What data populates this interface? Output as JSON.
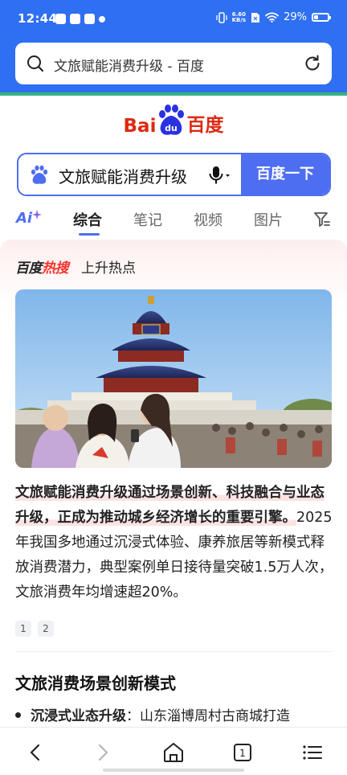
{
  "status_bar": {
    "time": "12:44",
    "net_speed_value": "6.60",
    "net_speed_unit": "KB/s",
    "battery_text": "29%",
    "battery_level": 0.29
  },
  "url_bar": {
    "text": "文旅赋能消费升级 - 百度"
  },
  "logo": {
    "left": "Bai",
    "paw": "du",
    "right": "百度"
  },
  "search": {
    "query": "文旅赋能消费升级",
    "button": "百度一下"
  },
  "tabs": {
    "ai": "Ai",
    "items": [
      "综合",
      "笔记",
      "视频",
      "图片"
    ],
    "active": "综合"
  },
  "hot": {
    "brand_a": "百度",
    "brand_b": "热搜",
    "subtitle": "上升热点"
  },
  "summary": {
    "highlight": "文旅赋能消费升级通过场景创新、科技融合与业态升级，正成为推动城乡经济增长的重要引擎。",
    "body": "2025年我国多地通过沉浸式体验、康养旅居等新模式释放消费潜力，典型案例单日接待量突破1.5万人次，文旅消费年均增速超20%。"
  },
  "refs": [
    "1",
    "2"
  ],
  "section": {
    "title": "文旅消费场景创新模式",
    "bullet_bold": "沉浸式业态升级",
    "bullet_text": "：山东淄博周村古商城打造"
  },
  "colors": {
    "brand_blue": "#4e6ef2",
    "browser_blue": "#2f6ff2",
    "baidu_red": "#de2910",
    "hot_red": "#f5352e"
  }
}
